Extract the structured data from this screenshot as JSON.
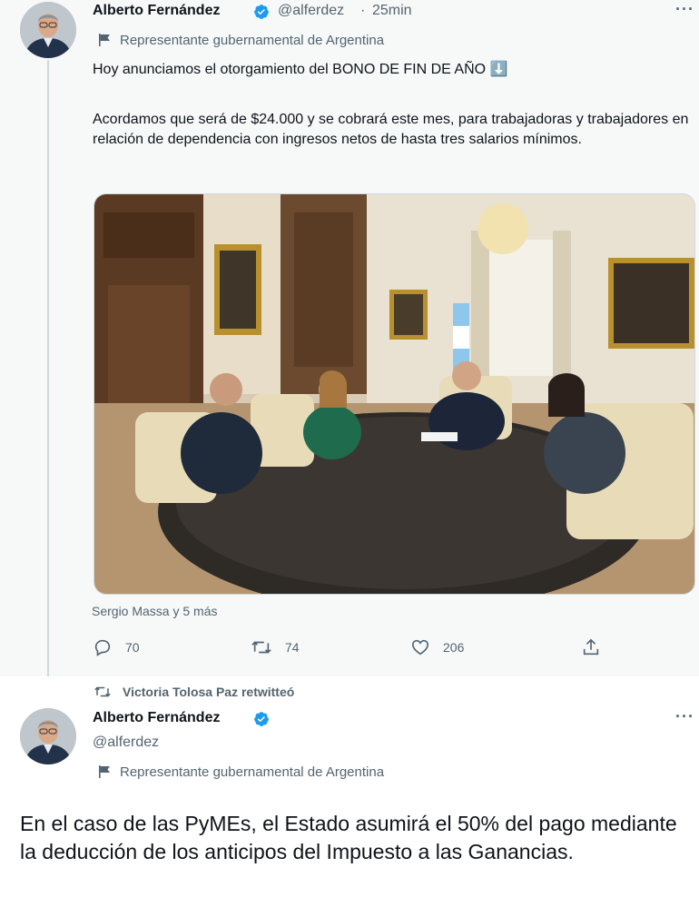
{
  "tweet1": {
    "author_name": "Alberto Fernández",
    "handle": "@alferdez",
    "separator": "·",
    "time": "25min",
    "more_label": "···",
    "gov_label": "Representante gubernamental de Argentina",
    "text_line1": "Hoy anunciamos el otorgamiento del BONO DE FIN DE AÑO ⬇️",
    "text_para2": "Acordamos que será de $24.000 y se cobrará este mes, para trabajadoras y trabajadores en relación de dependencia con ingresos netos de hasta tres salarios mínimos.",
    "tagged": "Sergio Massa y 5 más",
    "actions": {
      "replies": "70",
      "retweets": "74",
      "likes": "206"
    }
  },
  "retweet_context": {
    "label": "Victoria Tolosa Paz retwitteó"
  },
  "tweet2": {
    "author_name": "Alberto Fernández",
    "handle": "@alferdez",
    "more_label": "···",
    "gov_label": "Representante gubernamental de Argentina",
    "text": "En el caso de las PyMEs, el Estado asumirá el 50% del pago mediante la deducción de los anticipos del Impuesto a las Ganancias."
  },
  "colors": {
    "verified_blue": "#1d9bf0",
    "secondary_text": "#536471",
    "thread_line": "#cfd9de"
  },
  "icons": [
    "verified-badge-icon",
    "government-flag-icon",
    "reply-icon",
    "retweet-icon",
    "like-icon",
    "share-icon",
    "more-icon"
  ]
}
